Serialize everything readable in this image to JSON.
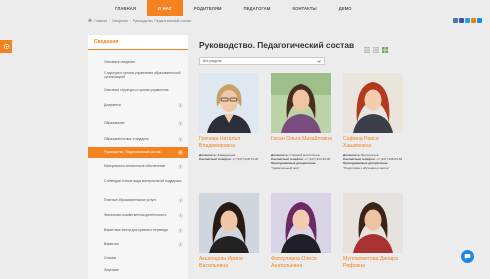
{
  "nav": {
    "items": [
      {
        "label": "ГЛАВНАЯ",
        "active": false
      },
      {
        "label": "О НАС",
        "active": true
      },
      {
        "label": "РОДИТЕЛЯМ",
        "active": false
      },
      {
        "label": "ПЕДАГОГАМ",
        "active": false
      },
      {
        "label": "КОНТАКТЫ",
        "active": false
      },
      {
        "label": "ДЕМО",
        "active": false
      }
    ]
  },
  "breadcrumb": [
    "Главная",
    "Сведения",
    "Руководство. Педагогический состав"
  ],
  "sidebar": {
    "title": "Сведения",
    "items": [
      {
        "label": "Основные сведения",
        "has_toggle": false
      },
      {
        "label": "Структура и органы управления образовательной организацией",
        "has_toggle": false
      },
      {
        "label": "Описание структуры и органа управления",
        "has_toggle": false
      },
      {
        "label": "Документы",
        "has_toggle": true
      },
      {
        "label": "Образование",
        "has_toggle": true
      },
      {
        "label": "Образовательные стандарты",
        "has_toggle": true
      },
      {
        "label": "Руководство. Педагогический состав",
        "has_toggle": true,
        "active": true
      },
      {
        "label": "Материально-техническое обеспечение",
        "has_toggle": true
      },
      {
        "label": "Стипендии и иные виды материальной поддержки",
        "has_toggle": false
      },
      {
        "label": "Платные образовательные услуги",
        "has_toggle": true
      },
      {
        "label": "Финансово-хозяйственная деятельность",
        "has_toggle": true
      },
      {
        "label": "Вакантные места для приема и перевода",
        "has_toggle": true
      },
      {
        "label": "Вакансии",
        "has_toggle": true
      },
      {
        "label": "Отзывы",
        "has_toggle": false
      },
      {
        "label": "Лицензии",
        "has_toggle": false
      }
    ]
  },
  "page": {
    "title": "Руководство. Педагогический состав",
    "filter_value": "Все разделы"
  },
  "staff": [
    {
      "name": "Грачева Наталья Владимировна",
      "position_label": "Должность:",
      "position": "Заведующая",
      "phone_label": "Контактный телефон:",
      "phone": "+7 (347) 228-73-36",
      "disciplines_label": "",
      "disciplines": ""
    },
    {
      "name": "Гасан Ольга Михайловна",
      "position_label": "Должность:",
      "position": "Старший воспитатель",
      "phone_label": "Контактный телефон:",
      "phone": "+7 (347) 233-35-96",
      "disciplines_label": "Преподаваемые дисциплины:",
      "disciplines": "\"Удивительный мир\""
    },
    {
      "name": "Сафина Раиса Хашимовна",
      "position_label": "Должность:",
      "position": "Воспитатель",
      "phone_label": "Контактный телефон:",
      "phone": "+7 (347) 436-63-69",
      "disciplines_label": "Преподаваемые дисциплины:",
      "disciplines": "\"Подготовка к обучению в школе\""
    },
    {
      "name": "Акшенцева Ирина Васильевна"
    },
    {
      "name": "Фатхуллина Олеся Анатольевна"
    },
    {
      "name": "Муллахметова Динара Рифовна"
    }
  ],
  "colors": {
    "accent": "#f58220",
    "page_bg": "#ececec",
    "sidebar_bg": "#f6f6f6",
    "chat": "#1e88e5"
  }
}
